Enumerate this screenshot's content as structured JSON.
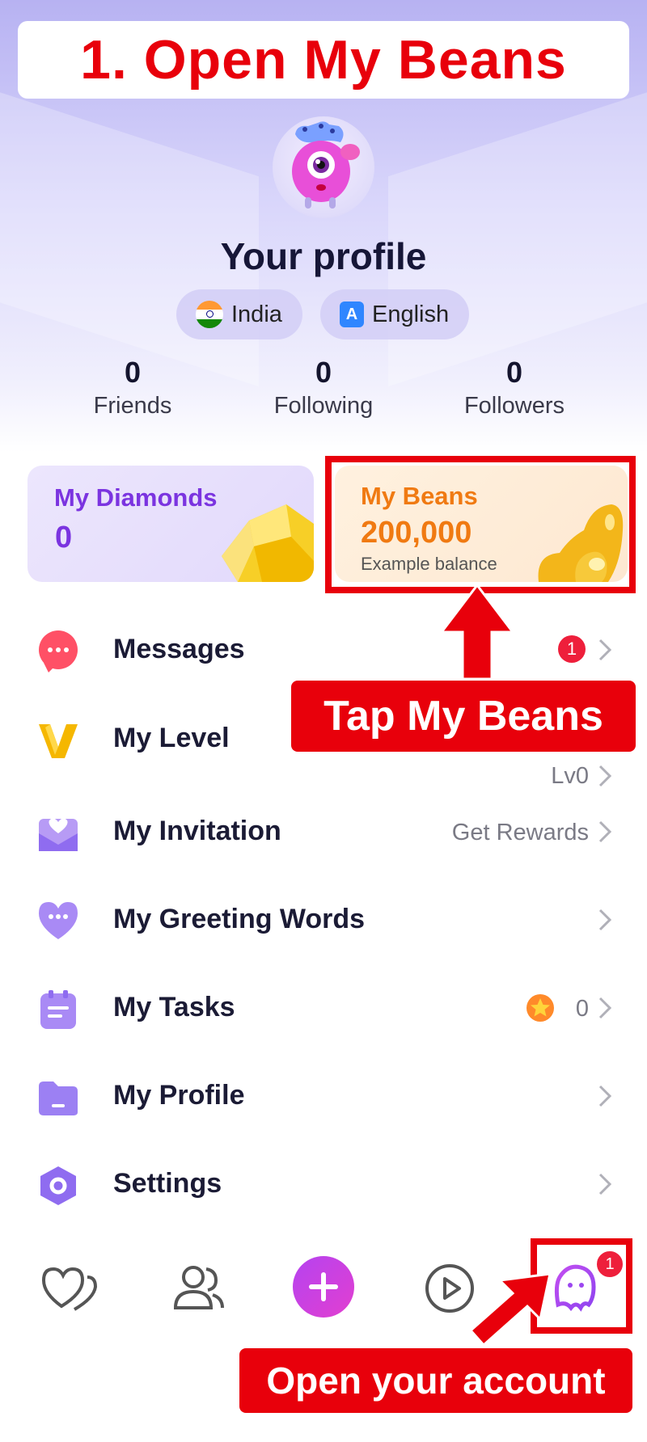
{
  "annotations": {
    "top_banner": "1. Open My Beans",
    "tap_label": "Tap My Beans",
    "account_label": "Open your account"
  },
  "profile": {
    "name": "Your profile",
    "country": "India",
    "language": "English",
    "language_icon_letter": "A",
    "stats": [
      {
        "value": "0",
        "label": "Friends"
      },
      {
        "value": "0",
        "label": "Following"
      },
      {
        "value": "0",
        "label": "Followers"
      }
    ]
  },
  "wallet": {
    "diamonds": {
      "title": "My Diamonds",
      "value": "0"
    },
    "beans": {
      "title": "My Beans",
      "value": "200,000",
      "subtitle": "Example balance"
    }
  },
  "menu": [
    {
      "label": "Messages",
      "icon": "message-bubble-icon",
      "badge": "1"
    },
    {
      "label": "My Level",
      "icon": "level-v-icon",
      "right": "Lv0"
    },
    {
      "label": "My Invitation",
      "icon": "invitation-envelope-icon",
      "right": "Get Rewards"
    },
    {
      "label": "My Greeting Words",
      "icon": "greeting-heart-icon"
    },
    {
      "label": "My Tasks",
      "icon": "tasks-clipboard-icon",
      "right": "0"
    },
    {
      "label": "My Profile",
      "icon": "profile-folder-icon"
    },
    {
      "label": "Settings",
      "icon": "settings-hexagon-icon"
    }
  ],
  "bottom_nav": {
    "items": [
      "hearts-icon",
      "friends-icon",
      "add-icon",
      "play-icon",
      "me-icon"
    ],
    "me_badge": "1"
  },
  "colors": {
    "accent_red": "#e8000b",
    "purple": "#7b34e0",
    "orange": "#f07a12"
  }
}
